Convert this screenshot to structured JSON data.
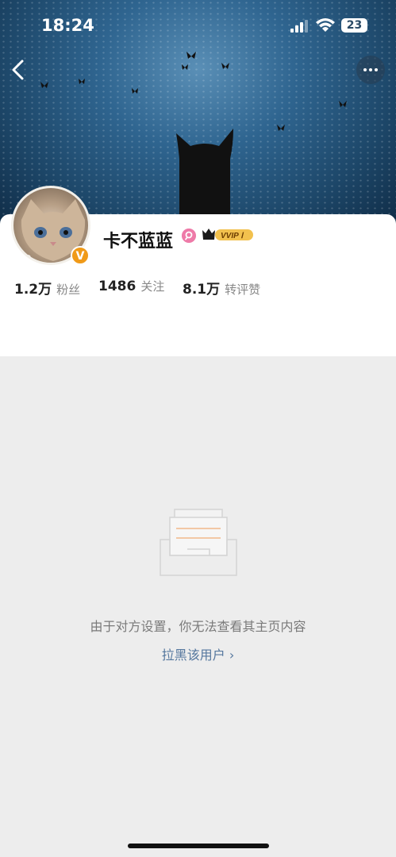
{
  "status_bar": {
    "time": "18:24",
    "battery": "23"
  },
  "profile": {
    "username": "卡不蓝蓝",
    "vip_label": "VVIP Ⅰ",
    "verified_badge": "V",
    "stats": [
      {
        "value": "1.2万",
        "label": "粉丝"
      },
      {
        "value": "1486",
        "label": "关注"
      },
      {
        "value": "8.1万",
        "label": "转评赞"
      }
    ]
  },
  "empty_state": {
    "message": "由于对方设置，你无法查看其主页内容",
    "block_link": "拉黑该用户 ›"
  },
  "colors": {
    "link": "#55779e",
    "badge_orange": "#f09a18",
    "vip_gold": "#f2c14e"
  }
}
